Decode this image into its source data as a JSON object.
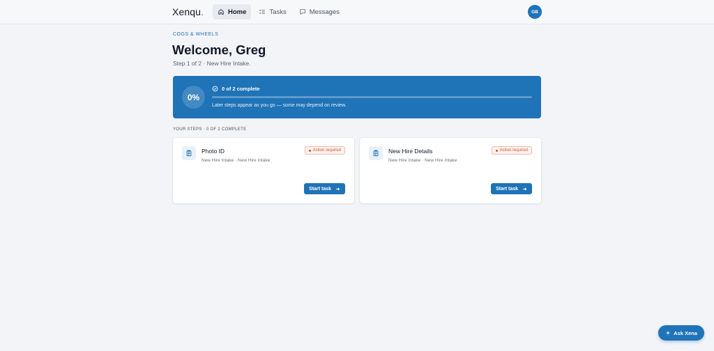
{
  "header": {
    "logo": "Xenqu",
    "logo_dot": ".",
    "nav": [
      {
        "label": "Home",
        "icon": "home-icon",
        "active": true
      },
      {
        "label": "Tasks",
        "icon": "list-icon",
        "active": false
      },
      {
        "label": "Messages",
        "icon": "message-icon",
        "active": false
      }
    ],
    "avatar_initials": "GB"
  },
  "main": {
    "eyebrow": "COGS & WHEELS",
    "title": "Welcome, Greg",
    "subtitle": "Step 1 of 2 · New Hire Intake."
  },
  "progress": {
    "percent_label": "0%",
    "percent_value": 0,
    "status": "0 of 2 complete",
    "note": "Later steps appear as you go — some may depend on review."
  },
  "steps_section": {
    "label": "YOUR STEPS · 0 OF 2 COMPLETE"
  },
  "tasks": [
    {
      "title": "Photo ID",
      "meta": "New Hire Intake · New Hire Intake",
      "badge": "Action required",
      "button": "Start task"
    },
    {
      "title": "New Hire Details",
      "meta": "New Hire Intake · New Hire Intake",
      "badge": "Action required",
      "button": "Start task"
    }
  ],
  "assistant": {
    "label": "Ask Xena"
  },
  "colors": {
    "brand": "#1f73b7",
    "badge": "#d0542a",
    "background": "#f3f4f7"
  }
}
